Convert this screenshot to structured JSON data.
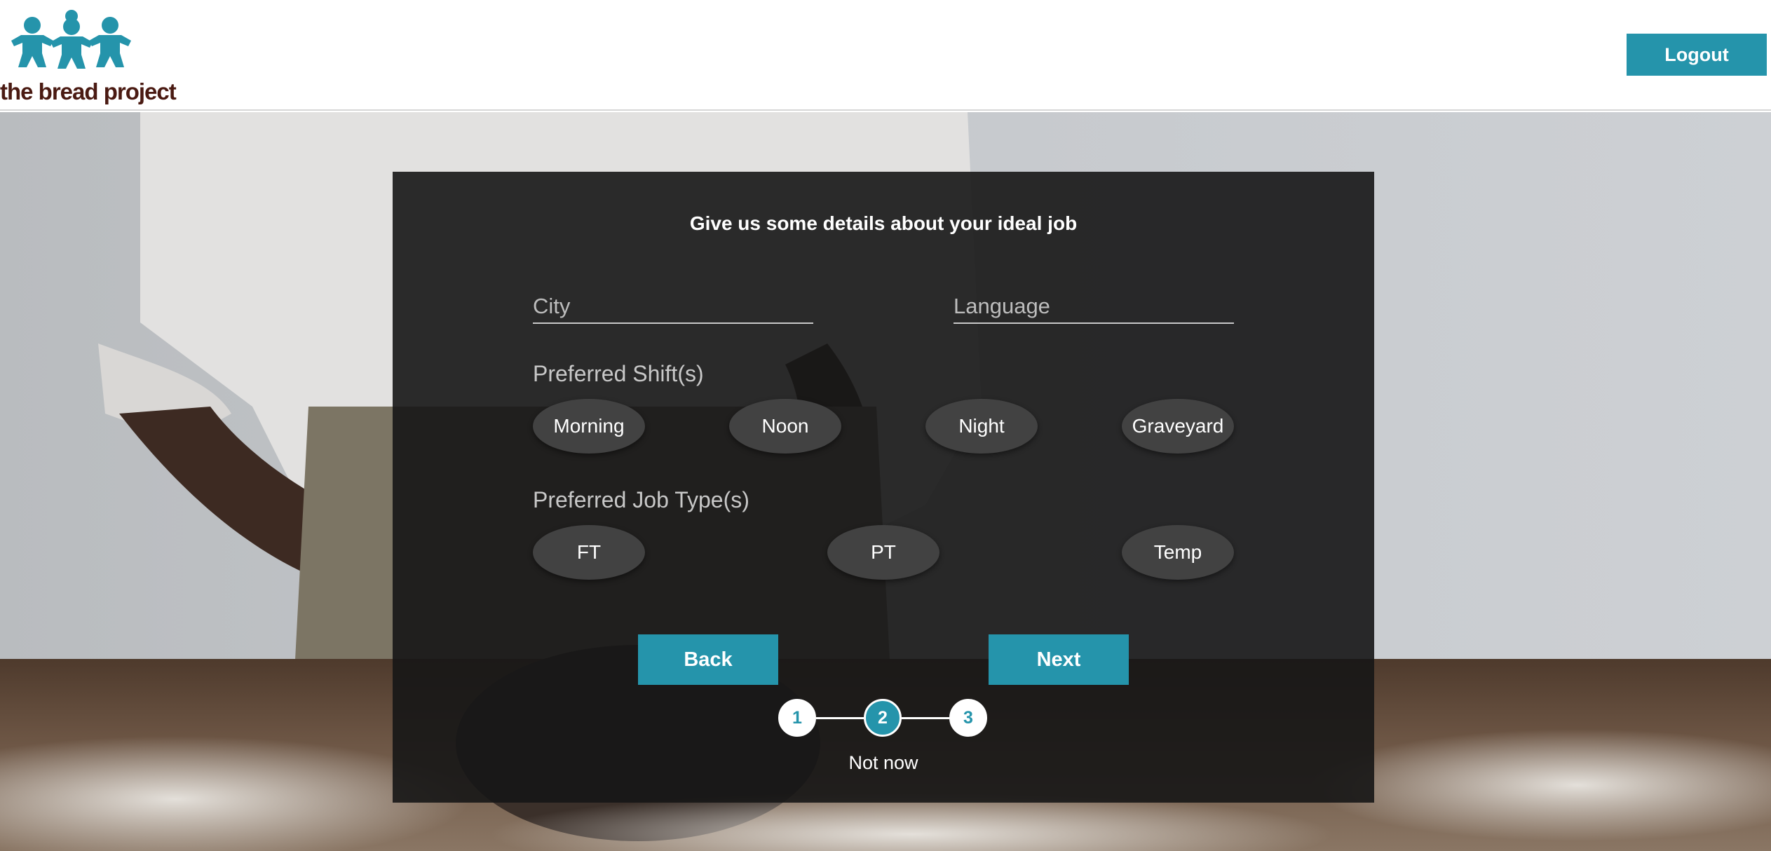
{
  "brand": {
    "name": "the bread project",
    "logo_icon": "three-bakers-icon",
    "color_primary": "#2594ab",
    "color_text_brown": "#4a1a12"
  },
  "header": {
    "logout_label": "Logout"
  },
  "form": {
    "title": "Give us some details about your ideal job",
    "city": {
      "placeholder": "City",
      "value": ""
    },
    "language": {
      "placeholder": "Language",
      "value": ""
    },
    "shifts": {
      "label": "Preferred Shift(s)",
      "options": [
        "Morning",
        "Noon",
        "Night",
        "Graveyard"
      ]
    },
    "job_types": {
      "label": "Preferred Job Type(s)",
      "options": [
        "FT",
        "PT",
        "Temp"
      ]
    },
    "back_label": "Back",
    "next_label": "Next",
    "steps": [
      "1",
      "2",
      "3"
    ],
    "current_step": 2,
    "not_now_label": "Not now"
  }
}
